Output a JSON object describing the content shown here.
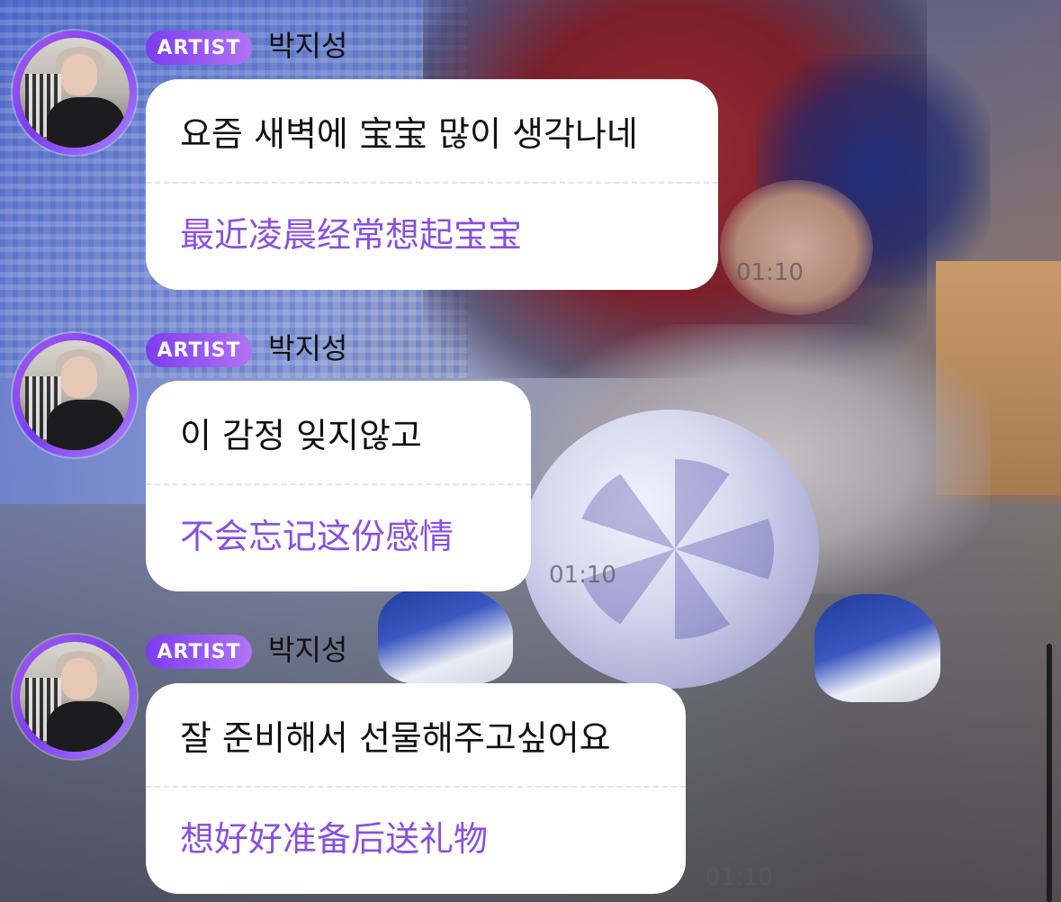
{
  "chat": {
    "messages": [
      {
        "badge": "ARTIST",
        "sender": "박지성",
        "text": "요즘 새벽에 宝宝 많이 생각나네",
        "translation": "最近凌晨经常想起宝宝",
        "time": "01:10"
      },
      {
        "badge": "ARTIST",
        "sender": "박지성",
        "text": "이 감정 잊지않고",
        "translation": "不会忘记这份感情",
        "time": "01:10"
      },
      {
        "badge": "ARTIST",
        "sender": "박지성",
        "text": "잘 준비해서 선물해주고싶어요",
        "translation": "想好好准备后送礼物",
        "time": "01:10"
      }
    ]
  },
  "colors": {
    "badge_gradient_start": "#7c3cf0",
    "badge_gradient_end": "#b173f5",
    "translation_text": "#8a4fe0",
    "bubble": "#ffffff"
  },
  "icons": {
    "avatar": "artist-profile-photo"
  }
}
